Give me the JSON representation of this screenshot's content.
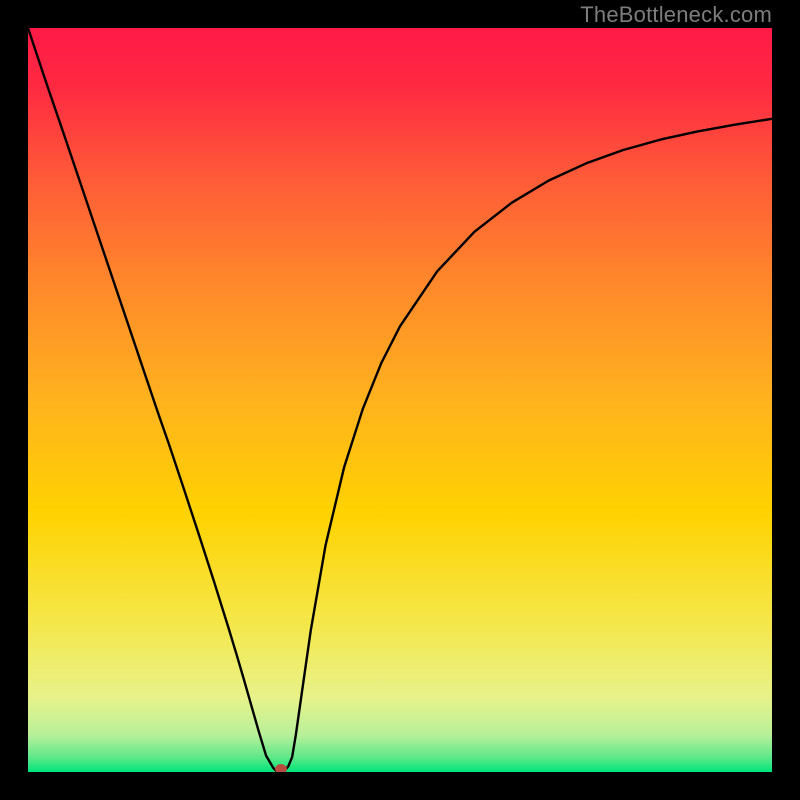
{
  "watermark": "TheBottleneck.com",
  "colors": {
    "background_frame": "#000000",
    "gradient_top": "#ff1a46",
    "gradient_mid": "#ffd200",
    "gradient_bottom": "#00e57a",
    "curve": "#000000",
    "marker": "#b84a3f",
    "watermark": "#7d7d7d"
  },
  "chart_data": {
    "type": "line",
    "title": "",
    "xlabel": "",
    "ylabel": "",
    "xlim": [
      0,
      100
    ],
    "ylim": [
      0,
      100
    ],
    "x": [
      0,
      2.5,
      5,
      7.5,
      10,
      12.5,
      15,
      17.5,
      19,
      21,
      23,
      25,
      27,
      28,
      29,
      30,
      31,
      32,
      33,
      33.5,
      34,
      34.5,
      35,
      35.5,
      36,
      37,
      38,
      40,
      42.5,
      45,
      47.5,
      50,
      55,
      60,
      65,
      70,
      75,
      80,
      85,
      90,
      95,
      100
    ],
    "values": [
      100,
      92.5,
      85.2,
      77.8,
      70.4,
      63,
      55.6,
      48.2,
      43.9,
      37.9,
      31.8,
      25.6,
      19.2,
      15.9,
      12.5,
      9,
      5.5,
      2.2,
      0.5,
      0,
      0,
      0.2,
      0.8,
      2,
      5,
      12,
      19,
      30.5,
      41,
      48.8,
      55,
      59.9,
      67.3,
      72.6,
      76.5,
      79.5,
      81.8,
      83.6,
      85,
      86.1,
      87,
      87.8
    ],
    "marker": {
      "x": 34,
      "y": 0
    },
    "grid": false,
    "legend": false
  }
}
